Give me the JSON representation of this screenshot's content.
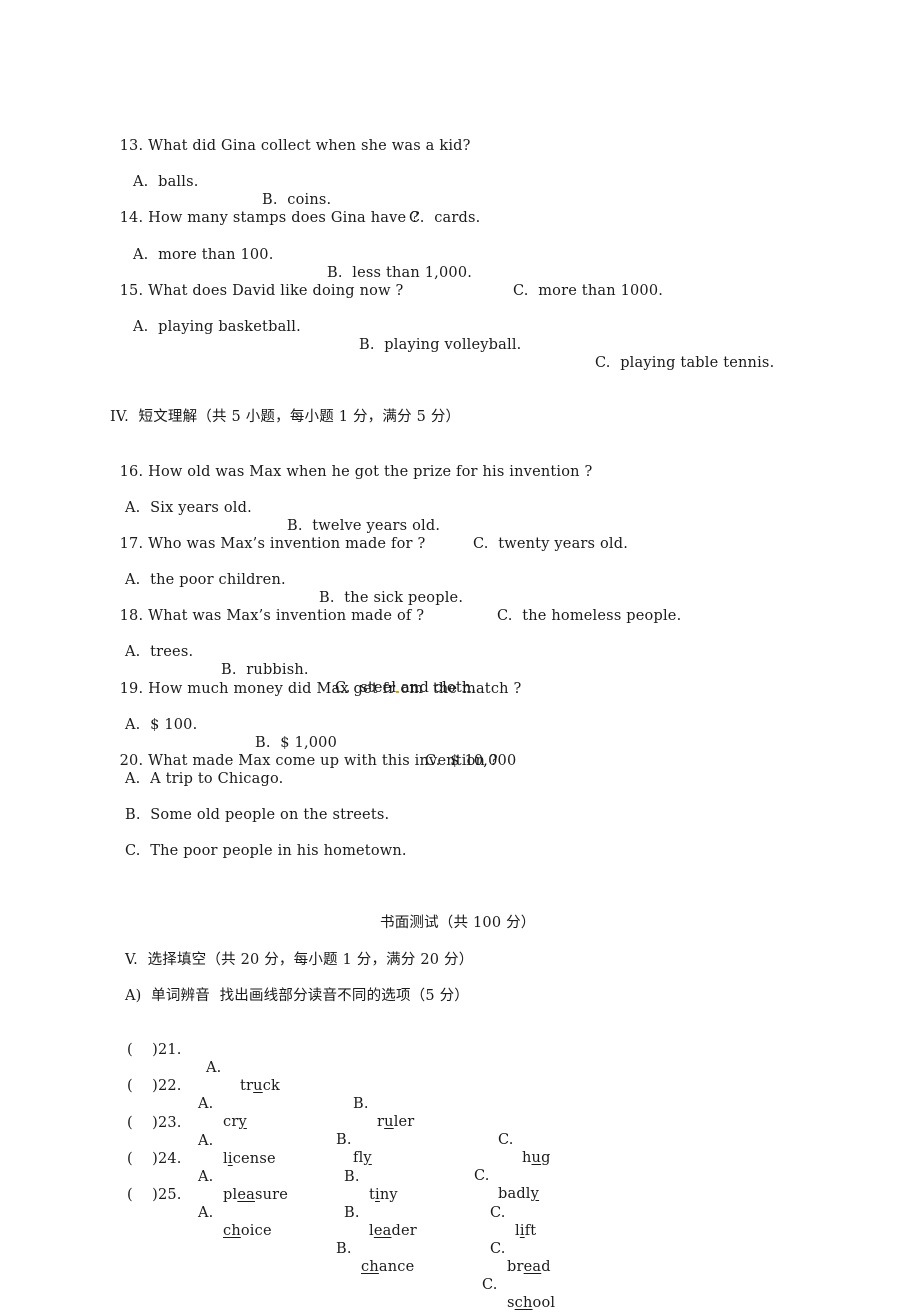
{
  "listening": {
    "questions": [
      {
        "num": "13.",
        "text": "What did Gina collect when she was a kid?",
        "options": [
          "A.  balls.",
          "B.  coins.",
          "C.  cards."
        ]
      },
      {
        "num": "14.",
        "text": "How many stamps does Gina have ?",
        "options": [
          "A.  more than 100.",
          "B.  less than 1,000.",
          "C.  more than 1000."
        ]
      },
      {
        "num": "15.",
        "text": "What does David like doing now ?",
        "options": [
          "A.  playing basketball.",
          "B.  playing volleyball.",
          "C.  playing table tennis."
        ]
      }
    ]
  },
  "section4": {
    "heading": "IV.  短文理解（共 5 小题，每小题 1 分，满分 5 分）",
    "questions": [
      {
        "num": "16.",
        "text": "How old was Max when he got the prize for his invention ?",
        "options": [
          "A.  Six years old.",
          "B.  twelve years old.",
          "C.  twenty years old."
        ]
      },
      {
        "num": "17.",
        "text": "Who was Max’s invention made for ?",
        "options": [
          "A.  the poor children.",
          "B.  the sick people.",
          "C.  the homeless people."
        ]
      },
      {
        "num": "18.",
        "text": "What was Max’s invention made of ?",
        "options": [
          "A.  trees.",
          "B.  rubbish.",
          "C.  steel and cloth."
        ]
      },
      {
        "num": "19.",
        "text_before": "How much money did Max get fr",
        "text_after": "om  the match ?",
        "options": [
          "A.  $ 100.",
          "B.  $ 1,000",
          "C.  $ 10,000"
        ]
      },
      {
        "num": "20.",
        "text": "What made Max come up with this invention ?",
        "options": [
          "A.  A trip to Chicago.",
          "B.  Some old people on the streets.",
          "C.  The poor people in his hometown."
        ]
      }
    ]
  },
  "written": {
    "title": "书面测试（共 100 分）",
    "section5_heading": "V.  选择填空（共 20 分，每小题 1 分，满分 20 分）",
    "partA_heading": "A)  单词辨音  找出画线部分读音不同的选项（5 分）",
    "items": [
      {
        "prefix": "(    )21.",
        "a_label": "A.",
        "a": [
          "tr",
          "u",
          "ck"
        ],
        "b_label": "B.",
        "b": [
          "r",
          "u",
          "ler"
        ],
        "c_label": "C.",
        "c": [
          "h",
          "u",
          "g"
        ]
      },
      {
        "prefix": "(    )22.",
        "a_label": "A.",
        "a": [
          "cr",
          "y",
          ""
        ],
        "b_label": "B.",
        "b": [
          "fl",
          "y",
          ""
        ],
        "c_label": "C.",
        "c": [
          "badl",
          "y",
          ""
        ]
      },
      {
        "prefix": "(    )23.",
        "a_label": "A.",
        "a": [
          "l",
          "i",
          "cense"
        ],
        "b_label": "B.",
        "b": [
          "t",
          "i",
          "ny"
        ],
        "c_label": "C.",
        "c": [
          "l",
          "i",
          "ft"
        ]
      },
      {
        "prefix": "(    )24.",
        "a_label": "A.",
        "a": [
          "pl",
          "ea",
          "sure"
        ],
        "b_label": "B.",
        "b": [
          "l",
          "ea",
          "der"
        ],
        "c_label": "C.",
        "c": [
          "br",
          "ea",
          "d"
        ]
      },
      {
        "prefix": "(    )25.",
        "a_label": "A.",
        "a": [
          "",
          "ch",
          "oice"
        ],
        "b_label": "B.",
        "b": [
          "",
          "ch",
          "ance"
        ],
        "c_label": "C.",
        "c": [
          "s",
          "ch",
          "ool"
        ]
      }
    ]
  }
}
